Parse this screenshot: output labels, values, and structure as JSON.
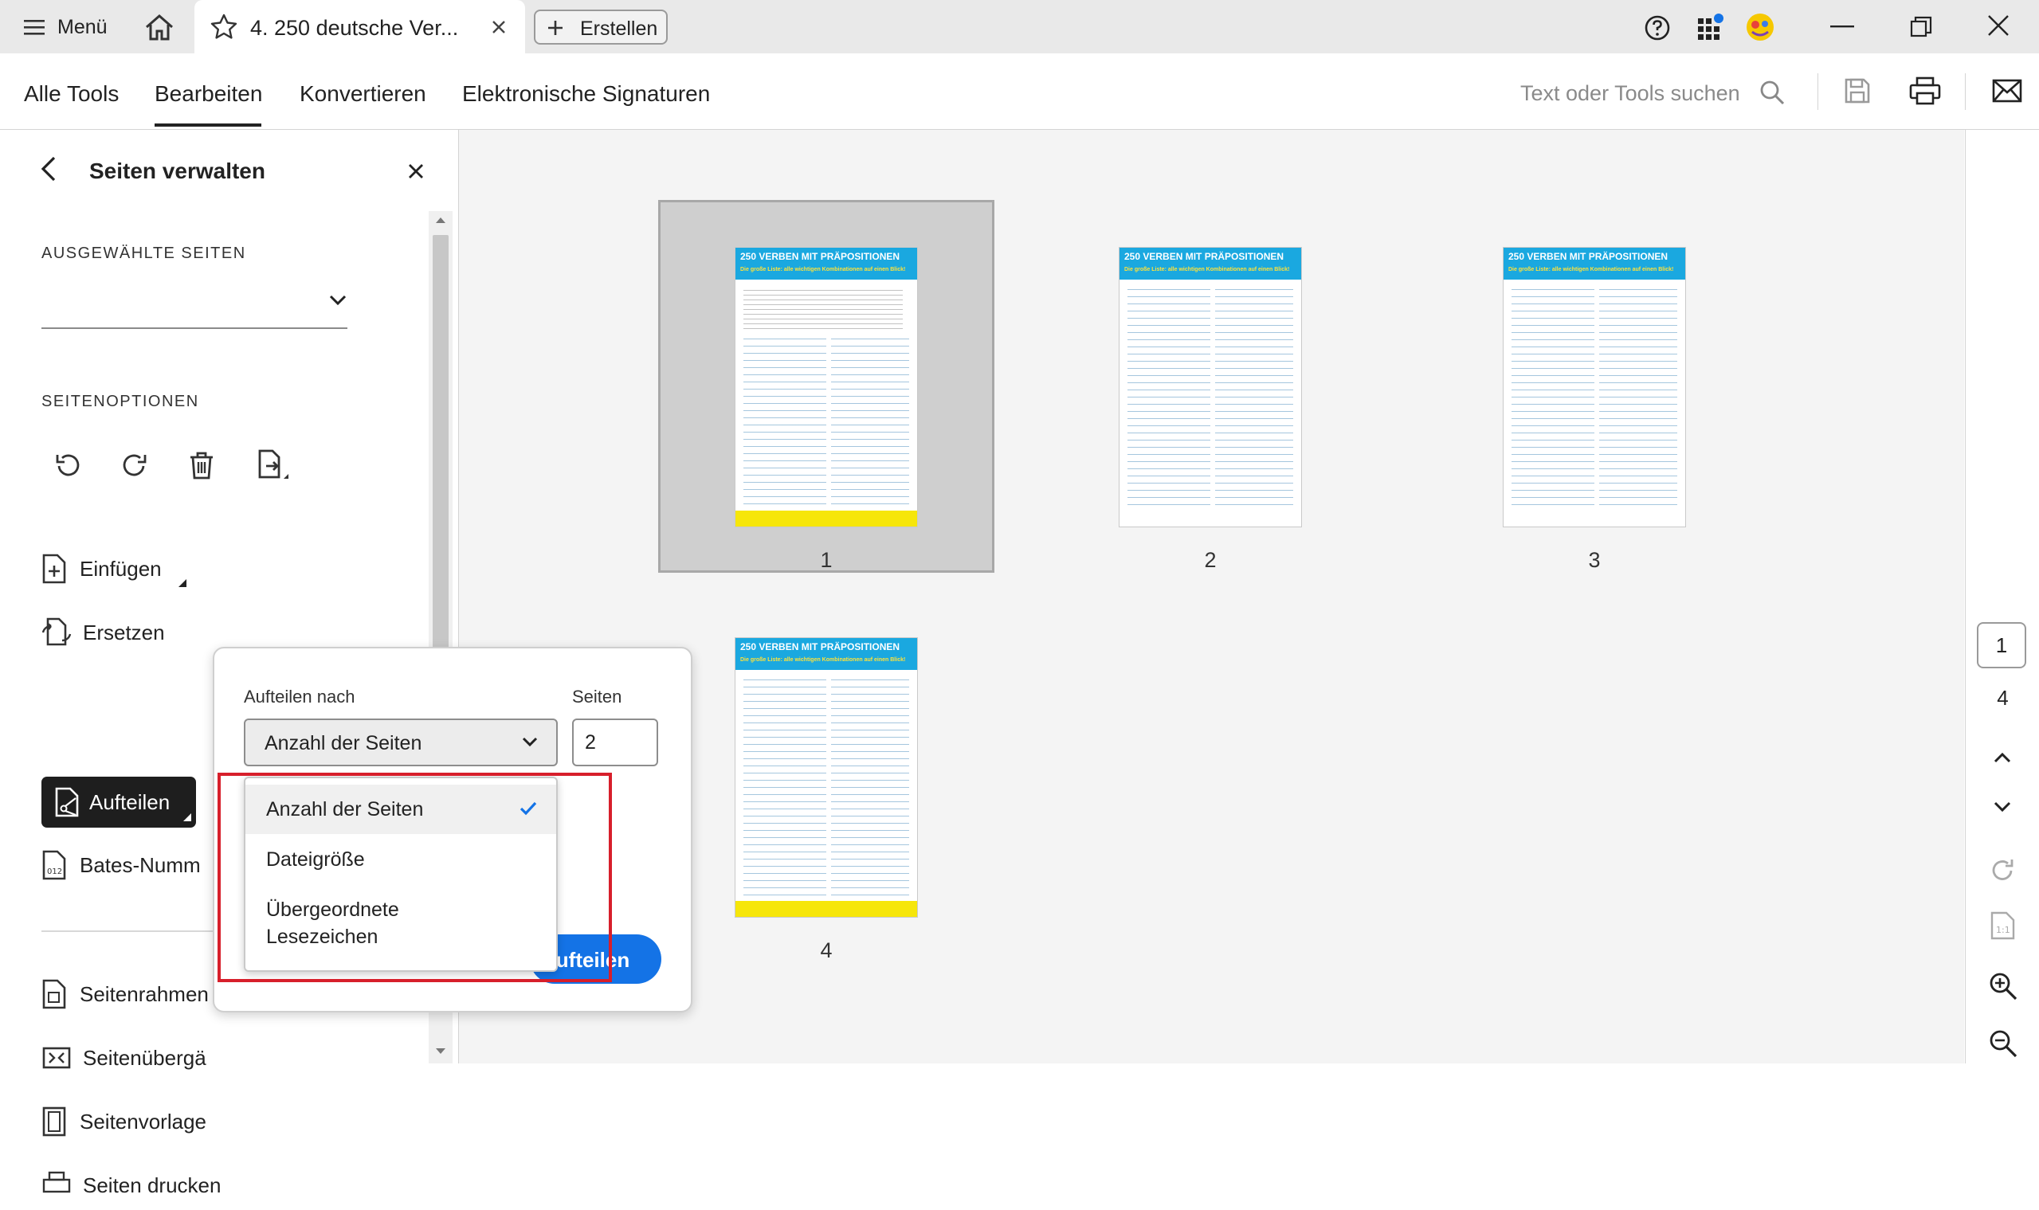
{
  "titlebar": {
    "menu_label": "Menü",
    "tab_title": "4. 250 deutsche Ver...",
    "create_label": "Erstellen"
  },
  "toolbar": {
    "tabs": [
      "Alle Tools",
      "Bearbeiten",
      "Konvertieren",
      "Elektronische Signaturen"
    ],
    "active_tab": "Bearbeiten",
    "search_placeholder": "Text oder Tools suchen"
  },
  "left_panel": {
    "title": "Seiten verwalten",
    "selected_pages_label": "AUSGEWÄHLTE SEITEN",
    "page_options_label": "SEITENOPTIONEN",
    "options": [
      {
        "label": "Einfügen"
      },
      {
        "label": "Ersetzen"
      },
      {
        "label": "Aufteilen"
      },
      {
        "label": "Bates-Numm"
      },
      {
        "label": "Seitenrahmen"
      },
      {
        "label": "Seitenübergä"
      },
      {
        "label": "Seitenvorlage"
      },
      {
        "label": "Seiten drucken"
      }
    ]
  },
  "thumbnails": [
    {
      "page": "1",
      "heading": "250 VERBEN MIT PRÄPOSITIONEN",
      "subheading": "Die große Liste: alle wichtigen Kombinationen auf einen Blick!"
    },
    {
      "page": "2",
      "heading": "250 VERBEN MIT PRÄPOSITIONEN",
      "subheading": "Die große Liste: alle wichtigen Kombinationen auf einen Blick!"
    },
    {
      "page": "3",
      "heading": "250 VERBEN MIT PRÄPOSITIONEN",
      "subheading": "Die große Liste: alle wichtigen Kombinationen auf einen Blick!"
    },
    {
      "page": "4",
      "heading": "250 VERBEN MIT PRÄPOSITIONEN",
      "subheading": "Die große Liste: alle wichtigen Kombinationen auf einen Blick!"
    }
  ],
  "right_rail": {
    "current_page": "1",
    "total_pages": "4"
  },
  "split_popup": {
    "split_by_label": "Aufteilen nach",
    "pages_label": "Seiten",
    "selected_option": "Anzahl der Seiten",
    "pages_value": "2",
    "action_label": "Aufteilen",
    "options": [
      "Anzahl der Seiten",
      "Dateigröße",
      "Übergeordnete",
      "Lesezeichen"
    ]
  },
  "colors": {
    "accent": "#1473e6",
    "highlight": "#d71f2b",
    "selected_thumb_bg": "#cfcfcf",
    "active_option_bg": "#1e1e1e"
  }
}
